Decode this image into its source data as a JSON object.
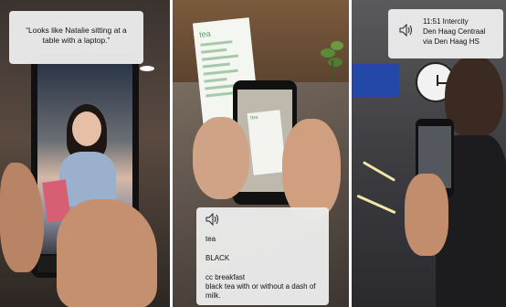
{
  "panels": {
    "left": {
      "caption": "“Looks like Natalie sitting at a table with a laptop.”"
    },
    "middle": {
      "menu_card_title": "tea",
      "phone_card_title": "tea",
      "caption_lines": [
        "tea",
        "BLACK",
        "cc breakfast",
        "black tea with or without a dash of milk."
      ]
    },
    "right": {
      "caption_lines": [
        "11:51  Intercity",
        "Den Haag Centraal",
        "via Den Haag HS"
      ]
    }
  },
  "icons": {
    "speaker": "speaker-icon"
  },
  "colors": {
    "bubble_bg": "#ececec",
    "blue_tab": "#3d7fd1",
    "menu_green": "#5aa46a"
  }
}
